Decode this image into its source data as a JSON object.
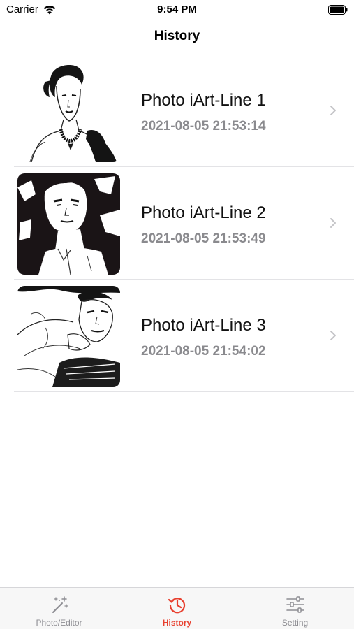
{
  "status_bar": {
    "carrier": "Carrier",
    "time": "9:54 PM"
  },
  "nav": {
    "title": "History"
  },
  "history": [
    {
      "title": "Photo iArt-Line 1",
      "date": "2021-08-05 21:53:14",
      "thumbnail": "line-art-woman-necklace"
    },
    {
      "title": "Photo iArt-Line 2",
      "date": "2021-08-05 21:53:49",
      "thumbnail": "line-art-man-portrait"
    },
    {
      "title": "Photo iArt-Line 3",
      "date": "2021-08-05 21:54:02",
      "thumbnail": "line-art-man-reclining"
    }
  ],
  "tabs": [
    {
      "label": "Photo/Editor",
      "icon": "magic-wand-icon",
      "active": false
    },
    {
      "label": "History",
      "icon": "history-clock-icon",
      "active": true
    },
    {
      "label": "Setting",
      "icon": "sliders-icon",
      "active": false
    }
  ],
  "colors": {
    "accent": "#e8402f",
    "inactive_tab": "#8e8e93",
    "date_text": "#8a8a8e"
  }
}
